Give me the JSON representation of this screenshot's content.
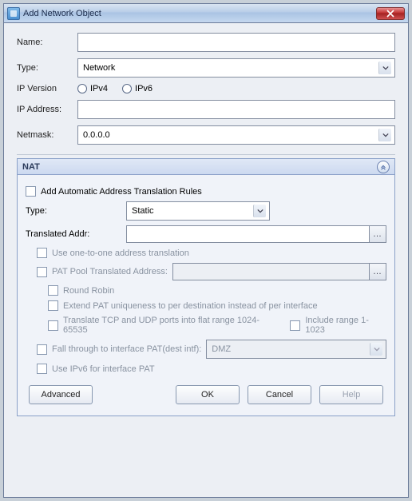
{
  "window": {
    "title": "Add Network Object"
  },
  "form": {
    "labels": {
      "name": "Name:",
      "type": "Type:",
      "ipversion": "IP Version",
      "ipaddress": "IP Address:",
      "netmask": "Netmask:"
    },
    "name_value": "",
    "type_value": "Network",
    "ipv4_label": "IPv4",
    "ipv6_label": "IPv6",
    "ip_value": "",
    "netmask_value": "0.0.0.0"
  },
  "nat": {
    "header": "NAT",
    "auto_rules_label": "Add Automatic Address Translation Rules",
    "type_label": "Type:",
    "type_value": "Static",
    "trans_addr_label": "Translated Addr:",
    "trans_addr_value": "",
    "one_to_one_label": "Use one-to-one address translation",
    "pat_pool_label": "PAT Pool Translated Address:",
    "pat_pool_value": "",
    "round_robin_label": "Round Robin",
    "extend_pat_label": "Extend PAT uniqueness to per destination instead of per interface",
    "flat_range_label": "Translate TCP and UDP ports into flat range 1024-65535",
    "include_1023_label": "Include range 1-1023",
    "fall_through_label": "Fall through to interface PAT(dest intf):",
    "interface_value": "DMZ",
    "use_ipv6_label": "Use IPv6 for interface PAT"
  },
  "buttons": {
    "advanced": "Advanced",
    "ok": "OK",
    "cancel": "Cancel",
    "help": "Help"
  }
}
